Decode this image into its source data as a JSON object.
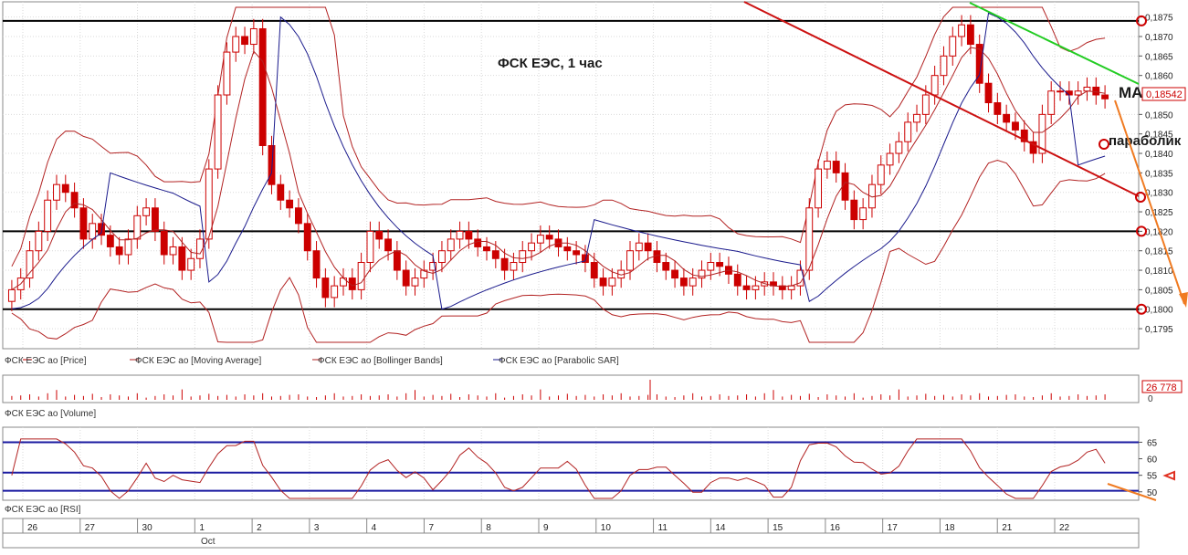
{
  "chart_data": {
    "type": "line",
    "title": "ФСК ЕЭС,  1 час",
    "price_panel": {
      "y_axis_ticks": [
        "0,1875",
        "0,1870",
        "0,1865",
        "0,1860",
        "0,1855",
        "0,1850",
        "0,1845",
        "0,1840",
        "0,1835",
        "0,1830",
        "0,1825",
        "0,1820",
        "0,1815",
        "0,1810",
        "0,1805",
        "0,1800",
        "0,1795"
      ],
      "ylim": [
        0.17915,
        0.18775
      ],
      "current_price_label": "0,18542",
      "horizontal_levels": [
        0.1874,
        0.182,
        0.18
      ],
      "annotations": {
        "ma": "MA",
        "parabolic": "параболик"
      },
      "legend": [
        {
          "label": "ФСК ЕЭС ао [Price]",
          "color": "#cc0000"
        },
        {
          "label": "ФСК ЕЭС ао [Moving Average]",
          "color": "#b22222"
        },
        {
          "label": "ФСК ЕЭС ао [Bollinger Bands]",
          "color": "#b22222"
        },
        {
          "label": "ФСК ЕЭС ао [Parabolic SAR]",
          "color": "#1a1a8c"
        }
      ],
      "close_series": [
        0.1805,
        0.1808,
        0.1815,
        0.182,
        0.1828,
        0.1832,
        0.183,
        0.1826,
        0.1818,
        0.1822,
        0.1819,
        0.1816,
        0.1814,
        0.1818,
        0.1824,
        0.1826,
        0.182,
        0.1814,
        0.1816,
        0.181,
        0.1813,
        0.1818,
        0.1836,
        0.1855,
        0.1866,
        0.187,
        0.1868,
        0.1872,
        0.1842,
        0.1832,
        0.1828,
        0.1826,
        0.1822,
        0.1815,
        0.1808,
        0.1803,
        0.1806,
        0.1808,
        0.1805,
        0.1812,
        0.182,
        0.1818,
        0.1815,
        0.181,
        0.1806,
        0.1808,
        0.181,
        0.1812,
        0.1815,
        0.1818,
        0.182,
        0.1818,
        0.1816,
        0.1815,
        0.1813,
        0.181,
        0.1812,
        0.1815,
        0.1817,
        0.1819,
        0.1818,
        0.1816,
        0.1815,
        0.1814,
        0.1812,
        0.1808,
        0.1806,
        0.1808,
        0.181,
        0.1815,
        0.1817,
        0.1815,
        0.1812,
        0.181,
        0.1808,
        0.1806,
        0.1808,
        0.181,
        0.1812,
        0.1811,
        0.1809,
        0.1806,
        0.1805,
        0.1806,
        0.1807,
        0.1806,
        0.1805,
        0.1806,
        0.181,
        0.1826,
        0.1836,
        0.1838,
        0.1835,
        0.1828,
        0.1823,
        0.1826,
        0.1832,
        0.1837,
        0.184,
        0.1843,
        0.1848,
        0.185,
        0.1855,
        0.186,
        0.1865,
        0.187,
        0.1873,
        0.1868,
        0.1858,
        0.1853,
        0.185,
        0.1848,
        0.1846,
        0.1843,
        0.184,
        0.185,
        0.1856,
        0.1856,
        0.1855,
        0.1856,
        0.1857,
        0.1855,
        0.1854
      ]
    },
    "volume_panel": {
      "legend": "ФСК ЕЭС ао [Volume]",
      "value_label": "26 778",
      "zero_label": "0",
      "spikes": [
        0.35,
        0.4,
        0.5,
        0.3,
        0.6,
        0.9,
        0.3,
        0.45,
        0.35,
        0.55,
        0.25,
        0.5,
        0.4,
        0.3,
        0.6,
        0.2,
        0.35,
        0.5,
        0.4,
        0.95,
        0.3,
        0.4,
        0.55,
        0.35,
        0.45,
        0.3,
        0.5,
        0.4,
        0.6,
        0.3,
        0.35,
        0.45,
        0.5,
        0.3,
        0.25,
        0.4,
        0.6,
        0.3,
        0.35,
        0.5
      ]
    },
    "rsi_panel": {
      "legend": "ФСК ЕЭС ао [RSI]",
      "y_ticks": [
        "65",
        "60",
        "55",
        "50"
      ],
      "levels": [
        65,
        55.8,
        50.3
      ]
    },
    "x_axis": {
      "labels": [
        "26",
        "27",
        "30",
        "1",
        "2",
        "3",
        "4",
        "7",
        "8",
        "9",
        "10",
        "11",
        "14",
        "15",
        "16",
        "17",
        "18",
        "21",
        "22"
      ],
      "month_label": "Oct"
    }
  }
}
